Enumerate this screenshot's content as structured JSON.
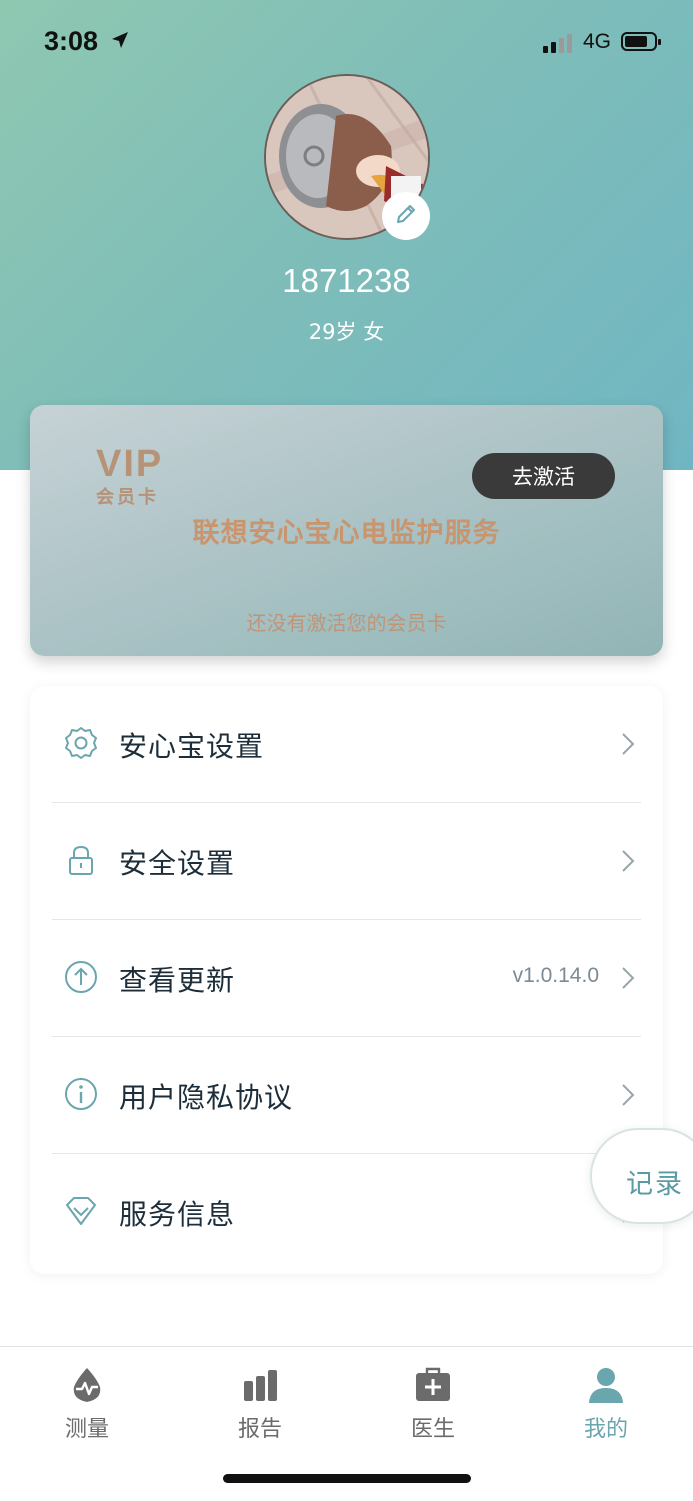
{
  "status_bar": {
    "time": "3:08",
    "network": "4G",
    "icons": [
      "location-arrow-icon",
      "signal-icon",
      "battery-icon"
    ]
  },
  "profile": {
    "user_id": "1871238",
    "meta": "29岁 女",
    "edit_icon": "pencil-icon"
  },
  "vip_card": {
    "title": "VIP",
    "subtitle": "会员卡",
    "activate_label": "去激活",
    "service_name": "联想安心宝心电监护服务",
    "status_text": "还没有激活您的会员卡"
  },
  "menu": {
    "items": [
      {
        "label": "安心宝设置",
        "icon": "gear-icon",
        "value": ""
      },
      {
        "label": "安全设置",
        "icon": "lock-icon",
        "value": ""
      },
      {
        "label": "查看更新",
        "icon": "upload-arrow-icon",
        "value": "v1.0.14.0"
      },
      {
        "label": "用户隐私协议",
        "icon": "info-icon",
        "value": ""
      },
      {
        "label": "服务信息",
        "icon": "diamond-icon",
        "value": ""
      }
    ]
  },
  "floating": {
    "record_label": "记录"
  },
  "tabbar": {
    "tabs": [
      {
        "label": "测量",
        "icon": "heart-pulse-icon",
        "active": false
      },
      {
        "label": "报告",
        "icon": "bar-chart-icon",
        "active": false
      },
      {
        "label": "医生",
        "icon": "medical-kit-icon",
        "active": false
      },
      {
        "label": "我的",
        "icon": "user-icon",
        "active": true
      }
    ]
  },
  "colors": {
    "header_gradient_start": "#8fc8b1",
    "header_gradient_end": "#70b6c2",
    "accent": "#6aa6ae",
    "vip_text": "#c8956e",
    "activate_button": "#3a3a3a"
  }
}
